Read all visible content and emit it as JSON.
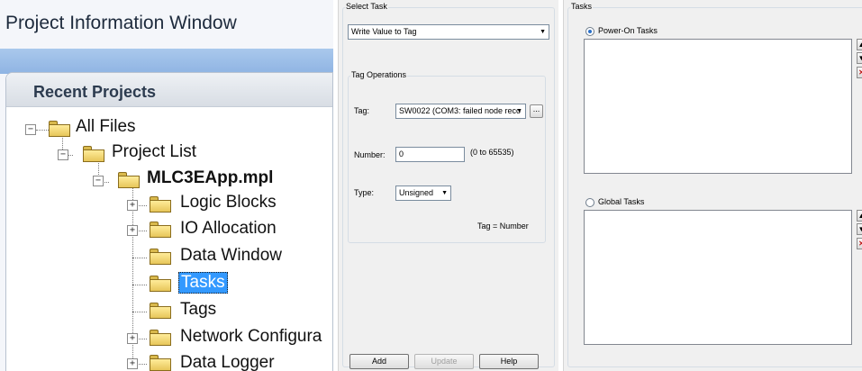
{
  "left": {
    "window_title": "Project Information Window",
    "panel_title": "Recent Projects",
    "tree": {
      "all_files": "All Files",
      "project_list": "Project List",
      "project_file": "MLC3EApp.mpl",
      "logic_blocks": "Logic Blocks",
      "io_allocation": "IO Allocation",
      "data_window": "Data Window",
      "tasks": "Tasks",
      "tags": "Tags",
      "network_configuration": "Network Configura",
      "data_logger": "Data Logger"
    },
    "expand_symbols": {
      "minus": "−",
      "plus": "+"
    }
  },
  "select_task": {
    "group_label": "Select Task",
    "task_combo_value": "Write Value to Tag",
    "tag_operations_label": "Tag Operations",
    "tag_label": "Tag:",
    "tag_combo_value": "SW0022 (COM3: failed node reco",
    "browse_button": "...",
    "number_label": "Number:",
    "number_value": "0",
    "number_range": "(0 to 65535)",
    "type_label": "Type:",
    "type_combo_value": "Unsigned",
    "formula": "Tag = Number",
    "add_button": "Add",
    "update_button": "Update",
    "help_button": "Help"
  },
  "tasks": {
    "group_label": "Tasks",
    "power_on_label": "Power-On Tasks",
    "power_on_selected": true,
    "global_label": "Global Tasks",
    "global_selected": false,
    "move_up_icon": "arrow-up-icon",
    "move_down_icon": "arrow-down-icon",
    "delete_icon": "delete-x-icon"
  },
  "colors": {
    "selection": "#3399ff",
    "band": "#9dbfe8",
    "delete": "#c01818"
  }
}
